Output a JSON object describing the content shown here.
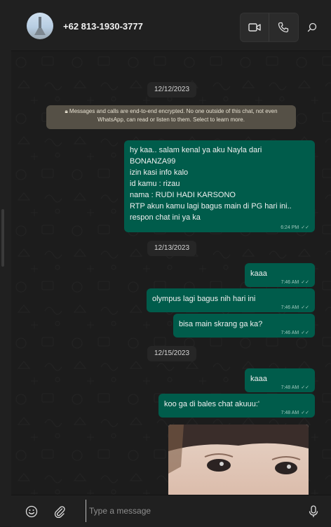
{
  "header": {
    "contact_name": "+62 813-1930-3777",
    "video_call_icon": "video-camera-icon",
    "voice_call_icon": "phone-icon",
    "search_icon": "search-icon"
  },
  "chat": {
    "dates": [
      "12/12/2023",
      "12/13/2023",
      "12/15/2023"
    ],
    "encryption_notice": "Messages and calls are end-to-end encrypted. No one outside of this chat, not even WhatsApp, can read or listen to them. Select to learn more.",
    "messages": [
      {
        "text": "hy kaa.. salam kenal ya aku Nayla dari\nBONANZA99\nizin kasi info kalo\nid kamu : rizau\nnama : RUDI HADI KARSONO\nRTP akun kamu lagi bagus main di PG hari ini..\nrespon chat ini ya ka",
        "time": "6:24 PM"
      },
      {
        "text": "kaaa",
        "time": "7:46 AM"
      },
      {
        "text": "olympus lagi bagus nih  hari ini",
        "time": "7:46 AM"
      },
      {
        "text": "bisa main skrang ga ka?",
        "time": "7:46 AM"
      },
      {
        "text": "kaaa",
        "time": "7:48 AM"
      },
      {
        "text": "koo ga di bales chat akuuu:'",
        "time": "7:48 AM"
      }
    ],
    "bubble_color": "#005c4b"
  },
  "footer": {
    "placeholder": "Type a message",
    "emoji_icon": "emoji-icon",
    "attach_icon": "paperclip-icon",
    "mic_icon": "microphone-icon"
  }
}
